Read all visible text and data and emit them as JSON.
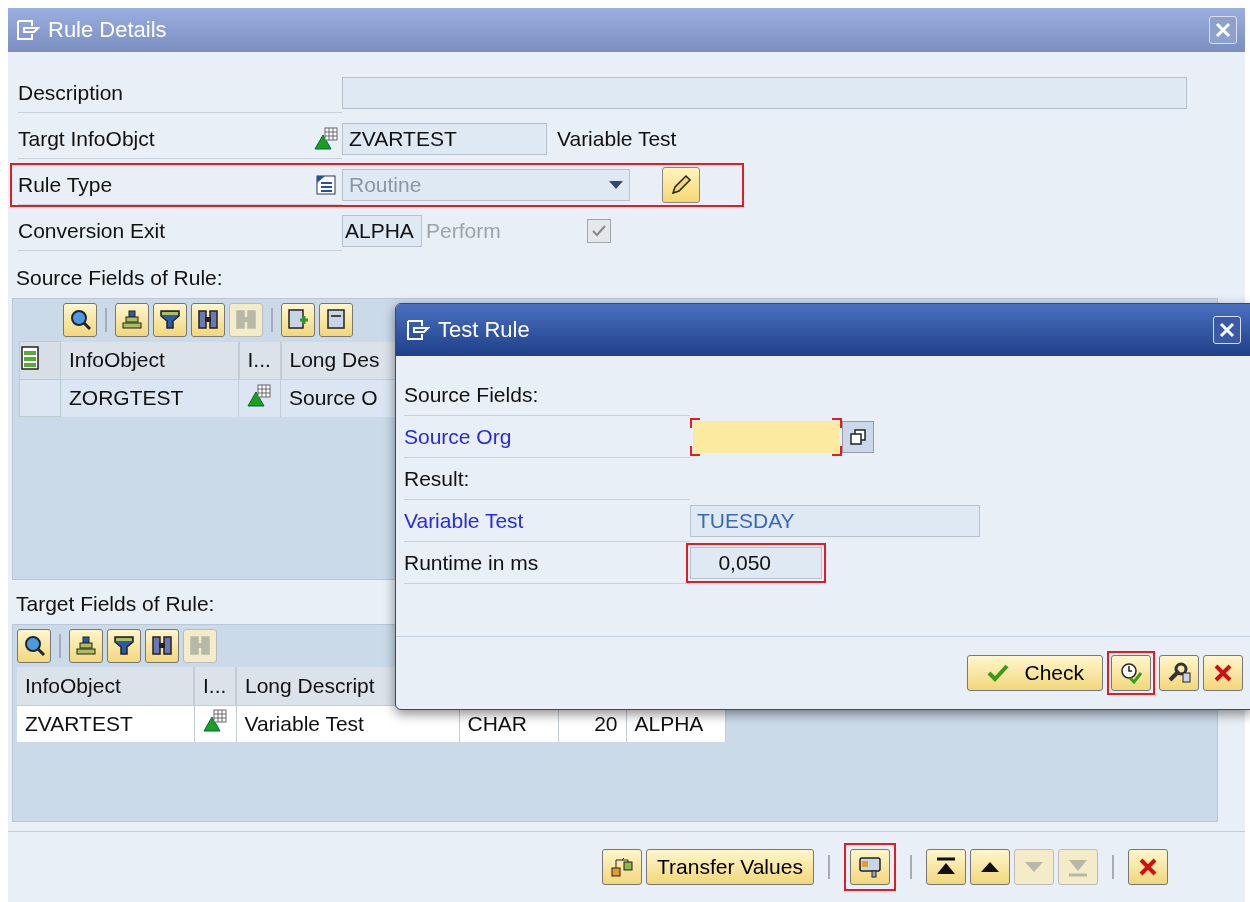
{
  "window": {
    "title": "Rule Details"
  },
  "form": [
    {
      "kind": "text",
      "label": "Description"
    },
    {
      "kind": "object",
      "label": "Targt InfoObjct",
      "value": "ZVARTEST",
      "text": "Variable Test"
    },
    {
      "kind": "dropdown",
      "label": "Rule Type",
      "value": "Routine",
      "disabled": true,
      "highlighted": true
    },
    {
      "kind": "exit",
      "label": "Conversion Exit",
      "value": "ALPHA",
      "option": "Perform",
      "checked": true,
      "disabled": true
    }
  ],
  "source": {
    "heading": "Source Fields of Rule:",
    "toolbar": [
      {
        "kind": "details",
        "disabled": false
      },
      {
        "kind": "sort-up",
        "disabled": false
      },
      {
        "kind": "filter",
        "disabled": false
      },
      {
        "kind": "find",
        "disabled": false
      },
      {
        "kind": "find-next",
        "disabled": true
      },
      {
        "kind": "insert",
        "disabled": false
      },
      {
        "kind": "delete",
        "disabled": false
      }
    ],
    "columns": [
      "InfoObject",
      "I...",
      "Long Des"
    ],
    "rows": [
      [
        "ZORGTEST",
        "",
        "Source O"
      ]
    ]
  },
  "target": {
    "heading": "Target Fields of Rule:",
    "toolbar": [
      {
        "kind": "details",
        "disabled": false
      },
      {
        "kind": "sort-up",
        "disabled": false
      },
      {
        "kind": "filter",
        "disabled": false
      },
      {
        "kind": "find",
        "disabled": false
      },
      {
        "kind": "find-next",
        "disabled": true
      }
    ],
    "columns": [
      "InfoObject",
      "I...",
      "Long Descript"
    ],
    "rows": [
      [
        "ZVARTEST",
        "",
        "Variable Test",
        "CHAR",
        "20",
        "ALPHA"
      ]
    ]
  },
  "footer": [
    {
      "kind": "hierarchy",
      "disabled": false,
      "highlighted": false
    },
    {
      "kind": "text",
      "label": "Transfer Values",
      "disabled": false,
      "highlighted": false
    },
    {
      "kind": "display",
      "disabled": false,
      "highlighted": true
    },
    {
      "kind": "first",
      "disabled": false,
      "highlighted": false
    },
    {
      "kind": "up",
      "disabled": false,
      "highlighted": false
    },
    {
      "kind": "down",
      "disabled": true,
      "highlighted": false
    },
    {
      "kind": "last",
      "disabled": true,
      "highlighted": false
    },
    {
      "kind": "cancel",
      "disabled": false,
      "highlighted": false
    }
  ],
  "dialog": {
    "title": "Test Rule",
    "rows": [
      {
        "kind": "heading",
        "label": "Source Fields:"
      },
      {
        "kind": "input",
        "label": "Source Org",
        "value": "",
        "required": true
      },
      {
        "kind": "heading",
        "label": "Result:"
      },
      {
        "kind": "output",
        "label": "Variable Test",
        "value": "TUESDAY"
      },
      {
        "kind": "runtime",
        "label": "Runtime in ms",
        "value": "0,050",
        "highlighted": true
      }
    ],
    "buttons": [
      {
        "kind": "check",
        "label": "Check",
        "highlighted": false
      },
      {
        "kind": "execute",
        "highlighted": true
      },
      {
        "kind": "settings",
        "highlighted": false
      },
      {
        "kind": "cancel",
        "highlighted": false
      }
    ]
  }
}
